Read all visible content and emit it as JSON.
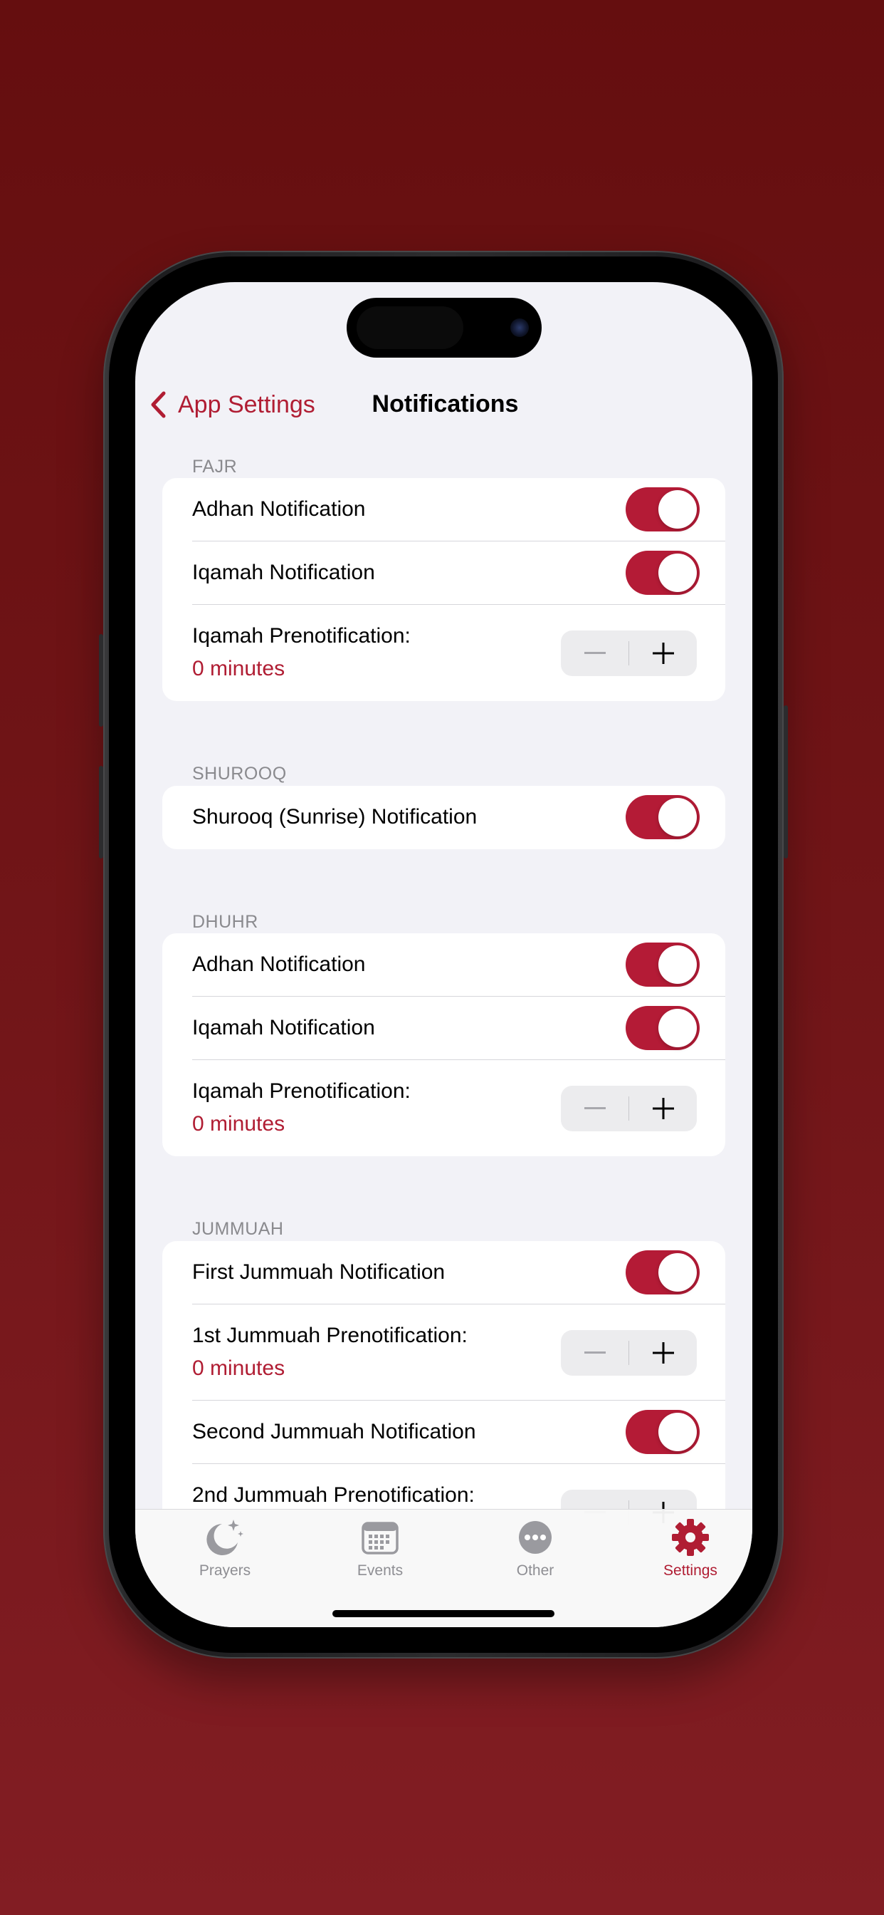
{
  "nav": {
    "back_label": "App Settings",
    "title": "Notifications"
  },
  "sections": {
    "fajr": {
      "header": "FAJR",
      "adhan_label": "Adhan Notification",
      "iqamah_label": "Iqamah Notification",
      "prenotif_label": "Iqamah Prenotification:",
      "prenotif_value": "0 minutes",
      "adhan_on": true,
      "iqamah_on": true
    },
    "shurooq": {
      "header": "SHUROOQ",
      "label": "Shurooq (Sunrise) Notification",
      "on": true
    },
    "dhuhr": {
      "header": "DHUHR",
      "adhan_label": "Adhan Notification",
      "iqamah_label": "Iqamah Notification",
      "prenotif_label": "Iqamah Prenotification:",
      "prenotif_value": "0 minutes",
      "adhan_on": true,
      "iqamah_on": true
    },
    "jummuah": {
      "header": "JUMMUAH",
      "first_label": "First Jummuah Notification",
      "first_prenotif_label": "1st Jummuah Prenotification:",
      "first_prenotif_value": "0 minutes",
      "second_label": "Second Jummuah Notification",
      "second_prenotif_label": "2nd Jummuah Prenotification:",
      "first_on": true,
      "second_on": true
    }
  },
  "tabbar": {
    "tabs": [
      {
        "label": "Prayers",
        "icon": "moon-stars-icon"
      },
      {
        "label": "Events",
        "icon": "calendar-icon"
      },
      {
        "label": "Other",
        "icon": "ellipsis-circle-icon"
      },
      {
        "label": "Settings",
        "icon": "gear-icon"
      }
    ],
    "active": "Settings"
  },
  "colors": {
    "accent": "#b01d33",
    "toggle_on": "#b41b36",
    "background": "#f2f2f7"
  }
}
